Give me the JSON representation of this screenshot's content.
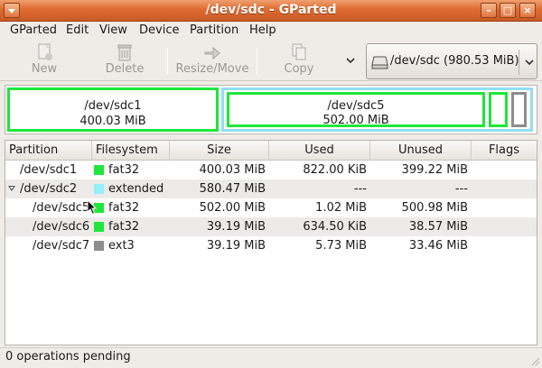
{
  "window": {
    "title": "/dev/sdc - GParted"
  },
  "menu": [
    "GParted",
    "Edit",
    "View",
    "Device",
    "Partition",
    "Help"
  ],
  "toolbar": {
    "new": "New",
    "delete": "Delete",
    "resize_move": "Resize/Move",
    "copy": "Copy",
    "device_selector": "/dev/sdc  (980.53 MiB)"
  },
  "diskmap": [
    {
      "name": "/dev/sdc1",
      "size": "400.03 MiB"
    },
    {
      "name": "/dev/sdc5",
      "size": "502.00 MiB"
    }
  ],
  "table": {
    "headers": [
      "Partition",
      "Filesystem",
      "Size",
      "Used",
      "Unused",
      "Flags"
    ],
    "rows": [
      {
        "partition": "/dev/sdc1",
        "filesystem": "fat32",
        "size": "400.03 MiB",
        "used": "822.00 KiB",
        "unused": "399.22 MiB",
        "flags": "",
        "color": "#1fe63a"
      },
      {
        "partition": "/dev/sdc2",
        "filesystem": "extended",
        "size": "580.47 MiB",
        "used": "---",
        "unused": "---",
        "flags": "",
        "color": "#92eff8"
      },
      {
        "partition": "/dev/sdc5",
        "filesystem": "fat32",
        "size": "502.00 MiB",
        "used": "1.02 MiB",
        "unused": "500.98 MiB",
        "flags": "",
        "color": "#1fe63a"
      },
      {
        "partition": "/dev/sdc6",
        "filesystem": "fat32",
        "size": "39.19 MiB",
        "used": "634.50 KiB",
        "unused": "38.57 MiB",
        "flags": "",
        "color": "#1fe63a"
      },
      {
        "partition": "/dev/sdc7",
        "filesystem": "ext3",
        "size": "39.19 MiB",
        "used": "5.73 MiB",
        "unused": "33.46 MiB",
        "flags": "",
        "color": "#8d8d8d"
      }
    ]
  },
  "status": {
    "text": "0 operations pending"
  },
  "colors": {
    "titlebar": "#df6b32",
    "fat32": "#1fe63a",
    "extended": "#92eff8",
    "ext3": "#8d8d8d"
  },
  "icons": [
    "window-menu-icon",
    "minimize-icon",
    "maximize-icon",
    "close-icon",
    "new-icon",
    "delete-icon",
    "resize-move-icon",
    "copy-icon",
    "drive-icon",
    "chevron-down-icon",
    "expander-icon",
    "resize-grip-icon"
  ]
}
